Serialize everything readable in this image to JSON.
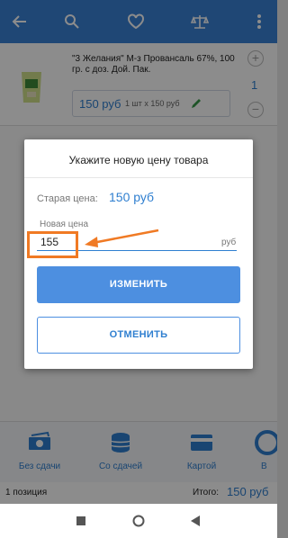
{
  "appbar": {
    "background": "#3a82d6",
    "icons": [
      "back-arrow-icon",
      "search-icon",
      "heart-icon",
      "scales-icon",
      "more-vert-icon"
    ]
  },
  "product": {
    "name": "\"3 Желания\" М-з Провансаль 67%, 100 гр.  с доз. Дой. Пак.",
    "price": "150 руб",
    "calc": "1 шт x 150 руб",
    "quantity": "1",
    "icons": [
      "product-thumbnail",
      "pencil-icon",
      "plus-icon",
      "minus-icon"
    ]
  },
  "dialog": {
    "title": "Укажите новую цену товара",
    "old_price_label": "Старая цена:",
    "old_price_value": "150 руб",
    "new_price_label": "Новая цена",
    "new_price_value": "155",
    "unit": "руб",
    "change_button": "ИЗМЕНИТЬ",
    "cancel_button": "ОТМЕНИТЬ"
  },
  "payments": [
    {
      "label": "Без сдачи",
      "icon": "cash-icon"
    },
    {
      "label": "Со сдачей",
      "icon": "coins-icon"
    },
    {
      "label": "Картой",
      "icon": "card-icon"
    },
    {
      "label": "В",
      "icon": "more-payment-icon"
    }
  ],
  "footer": {
    "positions": "1 позиция",
    "total_label": "Итого:",
    "total_value": "150 руб"
  },
  "colors": {
    "accent": "#3a82d6",
    "price_blue": "#2f7fd0",
    "button_blue": "#4d8fe0",
    "annotation": "#f07a24"
  }
}
